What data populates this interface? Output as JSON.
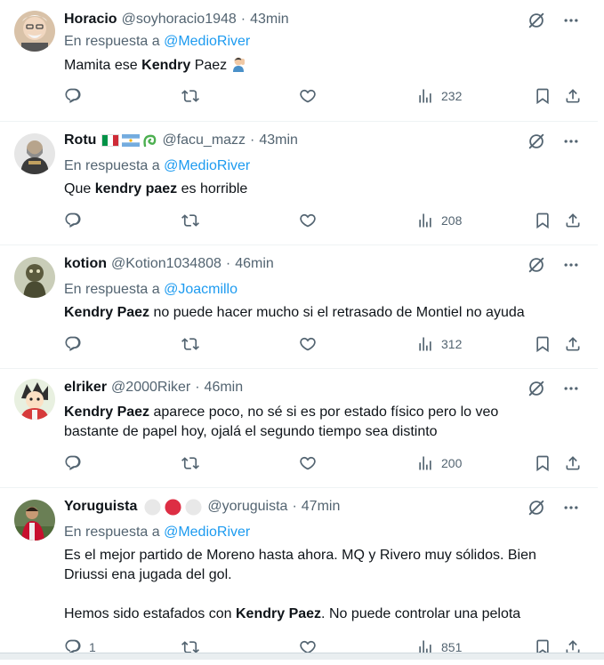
{
  "tweets": [
    {
      "name": "Horacio",
      "handle": "@soyhoracio1948",
      "sep": "·",
      "time": "43min",
      "reply_label": "En respuesta a",
      "reply_to": "@MedioRiver",
      "text_parts": [
        "Mamita ese ",
        "Kendry",
        " Paez "
      ],
      "emoji": "person-facepalm-emoji",
      "views": "232"
    },
    {
      "name": "Rotu",
      "flags": [
        "italy-flag",
        "argentina-flag",
        "green-swirl-emoji"
      ],
      "handle": "@facu_mazz",
      "sep": "·",
      "time": "43min",
      "reply_label": "En respuesta a",
      "reply_to": "@MedioRiver",
      "text_parts": [
        "Que ",
        "kendry paez",
        " es horrible"
      ],
      "views": "208"
    },
    {
      "name": "kotion",
      "handle": "@Kotion1034808",
      "sep": "·",
      "time": "46min",
      "reply_label": "En respuesta a",
      "reply_to": "@Joacmillo",
      "text_parts": [
        "Kendry Paez",
        " no puede hacer mucho si el retrasado de Montiel no ayuda"
      ],
      "views": "312"
    },
    {
      "name": "elriker",
      "handle": "@2000Riker",
      "sep": "·",
      "time": "46min",
      "text_parts": [
        "Kendry Paez",
        " aparece poco, no sé si es por estado físico pero lo veo",
        "bastante de papel hoy, ojalá el segundo tiempo sea distinto"
      ],
      "views": "200"
    },
    {
      "name": "Yoruguista",
      "badges": [
        "white-circle",
        "red-circle",
        "white-circle"
      ],
      "handle": "@yoruguista",
      "sep": "·",
      "time": "47min",
      "reply_label": "En respuesta a",
      "reply_to": "@MedioRiver",
      "text_lines": [
        "Es el mejor partido de Moreno hasta ahora. MQ y Rivero muy sólidos. Bien",
        "Driussi ena jugada del gol."
      ],
      "text_parts": [
        "Hemos sido estafados con ",
        "Kendry Paez",
        ". No puede controlar una pelota"
      ],
      "replies": "1",
      "views": "851"
    }
  ],
  "colors": {
    "link": "#1d9bf0",
    "muted": "#536471",
    "text": "#0f1419"
  }
}
